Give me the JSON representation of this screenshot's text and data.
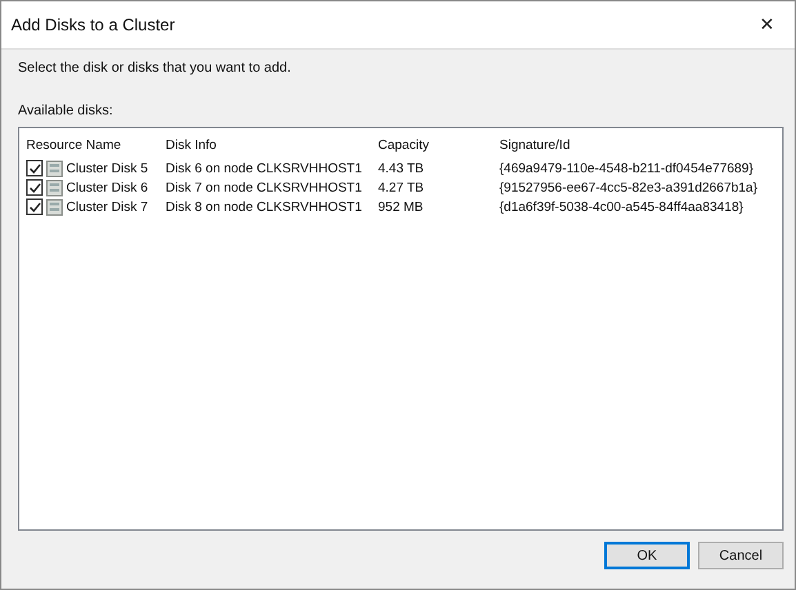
{
  "window": {
    "title": "Add Disks to a Cluster",
    "close": "✕"
  },
  "instruction": "Select the disk or disks that you want to add.",
  "list_label": "Available disks:",
  "table": {
    "columns": [
      "Resource Name",
      "Disk Info",
      "Capacity",
      "Signature/Id"
    ],
    "rows": [
      {
        "checked": true,
        "name": "Cluster Disk 5",
        "info": "Disk 6 on node CLKSRVHHOST1",
        "capacity": "4.43 TB",
        "signature": "{469a9479-110e-4548-b211-df0454e77689}"
      },
      {
        "checked": true,
        "name": "Cluster Disk 6",
        "info": "Disk 7 on node CLKSRVHHOST1",
        "capacity": "4.27 TB",
        "signature": "{91527956-ee67-4cc5-82e3-a391d2667b1a}"
      },
      {
        "checked": true,
        "name": "Cluster Disk 7",
        "info": "Disk 8 on node CLKSRVHHOST1",
        "capacity": "952 MB",
        "signature": "{d1a6f39f-5038-4c00-a545-84ff4aa83418}"
      }
    ]
  },
  "buttons": [
    {
      "label": "OK",
      "default": true
    },
    {
      "label": "Cancel",
      "default": false
    }
  ]
}
